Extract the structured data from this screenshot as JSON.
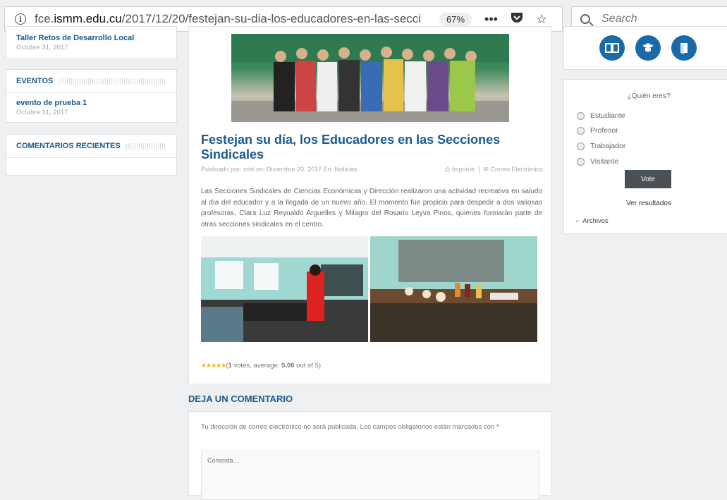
{
  "browser": {
    "url_prefix": "fce.",
    "url_domain": "ismm.edu.cu",
    "url_path": "/2017/12/20/festejan-su-dia-los-educadores-en-las-secci",
    "zoom": "67%",
    "search_placeholder": "Search"
  },
  "left_sidebar": {
    "top_item": {
      "link": "Taller Retos de Desarrollo Local",
      "date": "Octubre 31, 2017"
    },
    "events": {
      "title": "EVENTOS",
      "link": "evento de prueba 1",
      "date": "Octubre 31, 2017"
    },
    "comments": {
      "title": "COMENTARIOS RECIENTES"
    }
  },
  "post": {
    "title": "Festejan su día, los Educadores en las Secciones Sindicales",
    "meta_left": "Publicado por: root   on: Diciembre 20, 2017   En: Noticias",
    "print_label": "Imprimir",
    "email_label": "Correo Electrónico",
    "body": "Las Secciones Sindicales de Ciencias Económicas y Dirección realizaron una actividad recreativa en saludo al día del educador y a la llegada de un nuevo año.  El momento fue propicio para despedir a dos valiosas profesoras, Clara Luz Reynaldo Arguelles y Milagro del Rosario Leyva Pinos, quienes formarán parte de otras secciones sindicales en el centro.",
    "rating": {
      "stars": "★★★★★",
      "votes": "1",
      "votes_text": " votes, average: ",
      "average": "5,00",
      "out_of": " out of 5)",
      "open": "("
    }
  },
  "comment": {
    "heading": "DEJA UN COMENTARIO",
    "note": "Tu dirección de correo electrónico no será publicada. Los campos obligatorios están marcados con ",
    "required_mark": "*",
    "textarea_placeholder": "Comenta..."
  },
  "right_sidebar": {
    "poll": {
      "question": "¿Quién eres?",
      "options": [
        "Estudiante",
        "Profesor",
        "Trabajador",
        "Visitante"
      ],
      "vote_label": "Vote",
      "results_label": "Ver resultados"
    },
    "archives": "Archivos"
  }
}
